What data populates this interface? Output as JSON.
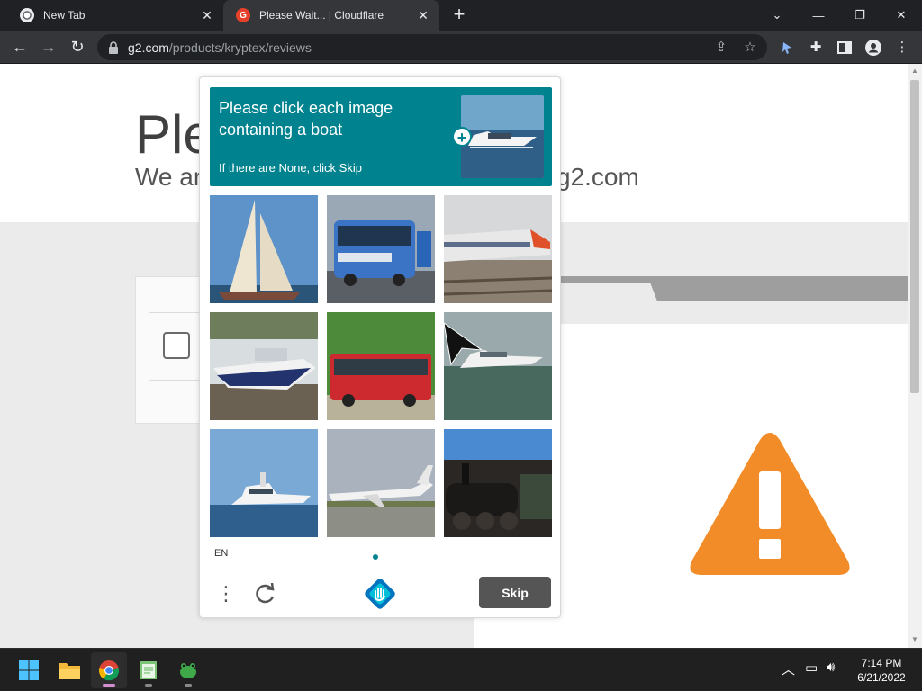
{
  "browser": {
    "tabs": [
      {
        "title": "New Tab",
        "close": "✕"
      },
      {
        "title": "Please Wait... | Cloudflare",
        "close": "✕",
        "favicon": "G"
      }
    ],
    "new_tab": "+",
    "url_host": "g2.com",
    "url_path": "/products/kryptex/reviews"
  },
  "page": {
    "heading": "Ple",
    "sub_left": "We ar",
    "sub_right": "g2.com"
  },
  "captcha": {
    "prompt": "Please click each image containing a boat",
    "hint": "If there are None, click Skip",
    "example_plus": "+",
    "tiles": [
      {
        "subject": "sailboat"
      },
      {
        "subject": "blue bus"
      },
      {
        "subject": "train"
      },
      {
        "subject": "motorboat on shore"
      },
      {
        "subject": "red bus"
      },
      {
        "subject": "yacht"
      },
      {
        "subject": "cruiser boat"
      },
      {
        "subject": "airplane"
      },
      {
        "subject": "steam locomotive"
      }
    ],
    "lang": "EN",
    "menu": "⋮",
    "skip": "Skip"
  },
  "taskbar": {
    "time": "7:14 PM",
    "date": "6/21/2022"
  },
  "colors": {
    "captcha_teal": "#00838f",
    "warning_orange": "#f28c28",
    "skip_gray": "#555555"
  },
  "icons": [
    "chrome-icon",
    "g2-favicon",
    "lock-icon",
    "share-icon",
    "star-icon",
    "extension-icon",
    "puzzle-icon",
    "sidepanel-icon",
    "profile-icon",
    "kebab-menu-icon",
    "warning-icon",
    "refresh-icon",
    "hcaptcha-logo",
    "windows-start-icon",
    "file-explorer-icon",
    "notepad-icon",
    "frog-app-icon"
  ]
}
